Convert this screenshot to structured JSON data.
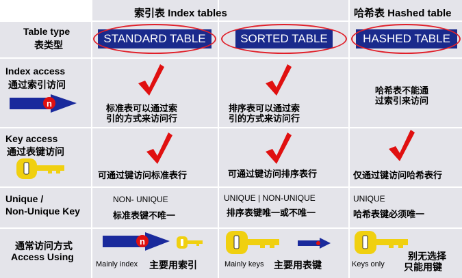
{
  "header": {
    "index_tables": "索引表  Index tables",
    "hashed_table": "哈希表  Hashed table"
  },
  "rows": {
    "table_type": {
      "en": "Table type",
      "zh": "表类型"
    },
    "index_access": {
      "en": "Index access",
      "zh": "通过索引访问"
    },
    "key_access": {
      "en": "Key access",
      "zh": "通过表键访问"
    },
    "unique": {
      "line1": "Unique /",
      "line2": "Non-Unique Key"
    },
    "access_using": {
      "zh": "通常访问方式",
      "en": "Access Using"
    }
  },
  "columns": {
    "standard": {
      "type_label": "STANDARD TABLE",
      "index_text": [
        "标准表可以通过索",
        "引的方式来访问行"
      ],
      "key_text": "可通过键访问标准表行",
      "unique_en": "NON- UNIQUE",
      "unique_zh": "标准表键不唯一",
      "access_small": "Mainly index",
      "access_zh": "主要用索引"
    },
    "sorted": {
      "type_label": "SORTED TABLE",
      "index_text": [
        "排序表可以通过索",
        "引的方式来访问行"
      ],
      "key_text": "可通过键访问排序表行",
      "unique_en": "UNIQUE | NON-UNIQUE",
      "unique_zh": "排序表键唯一或不唯一",
      "access_small": "Mainly keys",
      "access_zh": "主要用表键"
    },
    "hashed": {
      "type_label": "HASHED TABLE",
      "index_text": [
        "哈希表不能通",
        "过索引来访问"
      ],
      "key_text": "仅通过键访问哈希表行",
      "unique_en": "UNIQUE",
      "unique_zh": "哈希表键必须唯一",
      "access_small": "Keys only",
      "access_zh": [
        "别无选择",
        "只能用键"
      ]
    }
  },
  "icons": {
    "index_badge": "n",
    "check": "red-checkmark",
    "arrow": "blue-arrow",
    "key": "yellow-key"
  },
  "colors": {
    "bg": "#e4e4ea",
    "button": "#1a2a8c",
    "ellipse": "#e0202a",
    "check": "#e01010",
    "arrow": "#1a2a9c",
    "key": "#f0d010"
  }
}
